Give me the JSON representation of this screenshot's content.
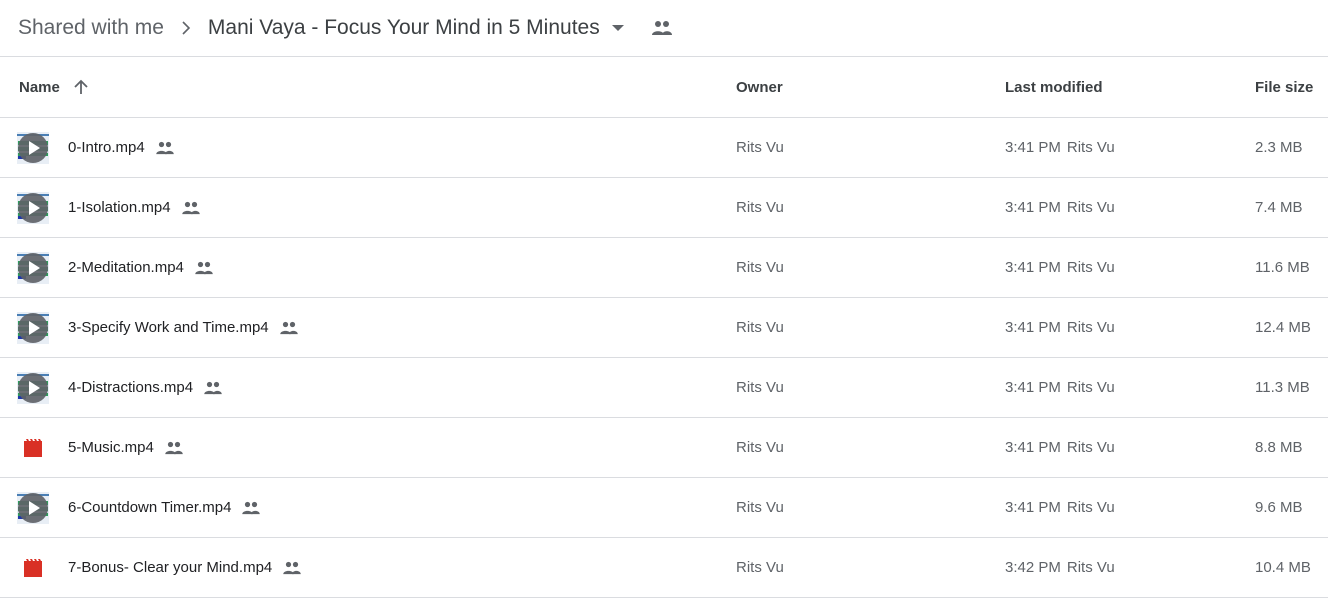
{
  "breadcrumb": {
    "root": "Shared with me",
    "current": "Mani Vaya - Focus Your Mind in 5 Minutes",
    "separator_icon": "chevron-right-icon",
    "dropdown_icon": "caret-down-icon",
    "shared_icon": "people-icon"
  },
  "table": {
    "headers": {
      "name": "Name",
      "owner": "Owner",
      "modified": "Last modified",
      "size": "File size",
      "sort_icon": "arrow-up-icon"
    },
    "rows": [
      {
        "name": "0-Intro.mp4",
        "thumb": "video-thumbnail",
        "owner": "Rits Vu",
        "time": "3:41 PM",
        "modified_by": "Rits Vu",
        "size": "2.3 MB"
      },
      {
        "name": "1-Isolation.mp4",
        "thumb": "video-thumbnail",
        "owner": "Rits Vu",
        "time": "3:41 PM",
        "modified_by": "Rits Vu",
        "size": "7.4 MB"
      },
      {
        "name": "2-Meditation.mp4",
        "thumb": "video-thumbnail",
        "owner": "Rits Vu",
        "time": "3:41 PM",
        "modified_by": "Rits Vu",
        "size": "11.6 MB"
      },
      {
        "name": "3-Specify Work and Time.mp4",
        "thumb": "video-thumbnail",
        "owner": "Rits Vu",
        "time": "3:41 PM",
        "modified_by": "Rits Vu",
        "size": "12.4 MB"
      },
      {
        "name": "4-Distractions.mp4",
        "thumb": "video-thumbnail",
        "owner": "Rits Vu",
        "time": "3:41 PM",
        "modified_by": "Rits Vu",
        "size": "11.3 MB"
      },
      {
        "name": "5-Music.mp4",
        "thumb": "video-file-icon",
        "owner": "Rits Vu",
        "time": "3:41 PM",
        "modified_by": "Rits Vu",
        "size": "8.8 MB"
      },
      {
        "name": "6-Countdown Timer.mp4",
        "thumb": "video-thumbnail",
        "owner": "Rits Vu",
        "time": "3:41 PM",
        "modified_by": "Rits Vu",
        "size": "9.6 MB"
      },
      {
        "name": "7-Bonus- Clear your Mind.mp4",
        "thumb": "video-file-icon",
        "owner": "Rits Vu",
        "time": "3:42 PM",
        "modified_by": "Rits Vu",
        "size": "10.4 MB"
      }
    ]
  },
  "colors": {
    "video_icon_red": "#d93025",
    "text_primary": "#202124",
    "text_secondary": "#5f6368",
    "divider": "#dadce0"
  }
}
